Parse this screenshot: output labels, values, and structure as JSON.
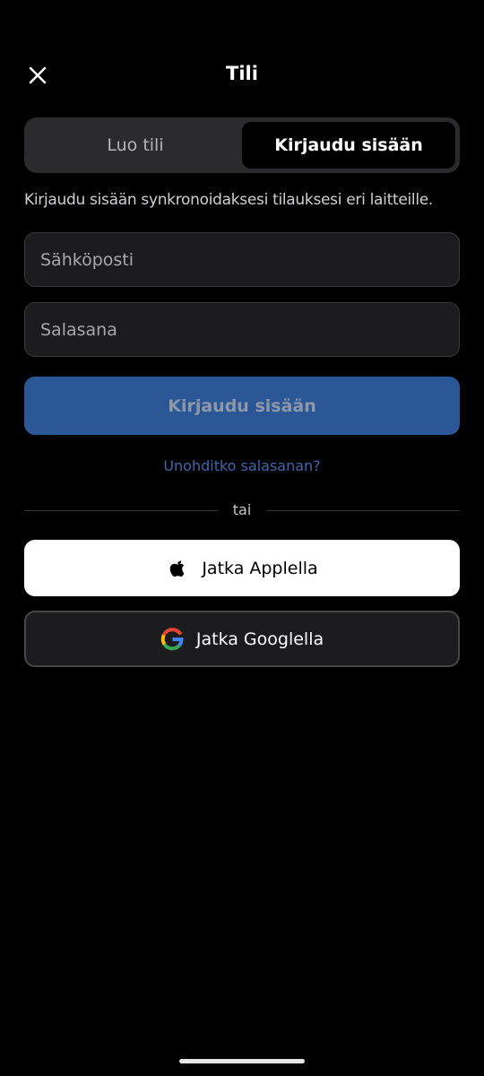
{
  "header": {
    "title": "Tili",
    "close_icon": "close-icon"
  },
  "tabs": [
    {
      "label": "Luo tili",
      "selected": false
    },
    {
      "label": "Kirjaudu sisään",
      "selected": true
    }
  ],
  "description": "Kirjaudu sisään synkronoidaksesi tilauksesi eri laitteille.",
  "form": {
    "email_placeholder": "Sähköposti",
    "email_value": "",
    "password_placeholder": "Salasana",
    "password_value": "",
    "submit_label": "Kirjaudu sisään",
    "forgot_label": "Unohditko salasanan?"
  },
  "divider": {
    "label": "tai"
  },
  "social": {
    "apple_label": "Jatka Applella",
    "google_label": "Jatka Googlella"
  },
  "colors": {
    "background": "#000000",
    "accent": "#2b5797",
    "link": "#3c68ad"
  }
}
